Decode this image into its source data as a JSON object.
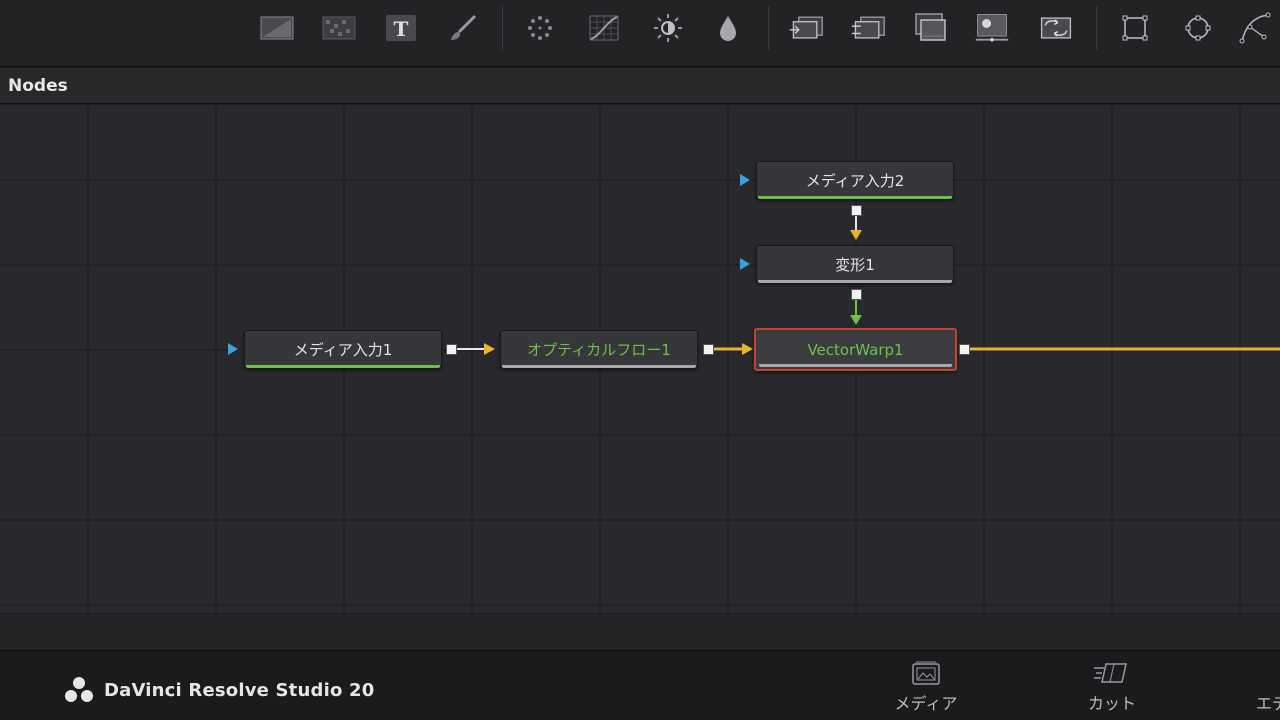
{
  "panel": {
    "title": "Nodes"
  },
  "toolbar": {
    "tools": [
      {
        "id": "background",
        "icon": "background-icon"
      },
      {
        "id": "fast-noise",
        "icon": "fast-noise-icon"
      },
      {
        "id": "text",
        "icon": "text-icon",
        "glyph": "T"
      },
      {
        "id": "paint",
        "icon": "paint-brush-icon"
      },
      {
        "id": "particles",
        "icon": "particles-icon"
      },
      {
        "id": "color-curves",
        "icon": "color-curves-icon"
      },
      {
        "id": "color-corrector",
        "icon": "color-corrector-icon"
      },
      {
        "id": "blur",
        "icon": "drop-icon"
      },
      {
        "id": "merge",
        "icon": "merge-icon"
      },
      {
        "id": "channel-booleans",
        "icon": "channel-booleans-icon"
      },
      {
        "id": "matte-control",
        "icon": "matte-control-icon"
      },
      {
        "id": "loader",
        "icon": "loader-icon"
      },
      {
        "id": "saver",
        "icon": "saver-icon"
      },
      {
        "id": "rectangle",
        "icon": "rectangle-mask-icon"
      },
      {
        "id": "ellipse",
        "icon": "ellipse-mask-icon"
      },
      {
        "id": "polygon",
        "icon": "polygon-mask-icon"
      }
    ]
  },
  "nodes": [
    {
      "id": "mediain2",
      "label": "メディア入力2",
      "underline": "#6dc14a"
    },
    {
      "id": "transform1",
      "label": "変形1",
      "underline": "#a8a8a8"
    },
    {
      "id": "mediain1",
      "label": "メディア入力1",
      "underline": "#6dc14a"
    },
    {
      "id": "opticalflow1",
      "label": "オプティカルフロー1",
      "underline": "#a8a8a8"
    },
    {
      "id": "vectorwarp1",
      "label": "VectorWarp1",
      "underline": "#a8a8a8"
    }
  ],
  "colors": {
    "accent_green": "#6dc14a",
    "link_yellow": "#e8b430",
    "selected_red": "#c6432e",
    "port_blue": "#3aa0e0"
  },
  "footer": {
    "brand": "DaVinci Resolve Studio 20",
    "pages": [
      {
        "id": "media",
        "label": "メディア",
        "icon": "media-page-icon"
      },
      {
        "id": "cut",
        "label": "カット",
        "icon": "cut-page-icon"
      },
      {
        "id": "edit",
        "label": "エデ",
        "icon": "edit-page-icon"
      }
    ]
  }
}
